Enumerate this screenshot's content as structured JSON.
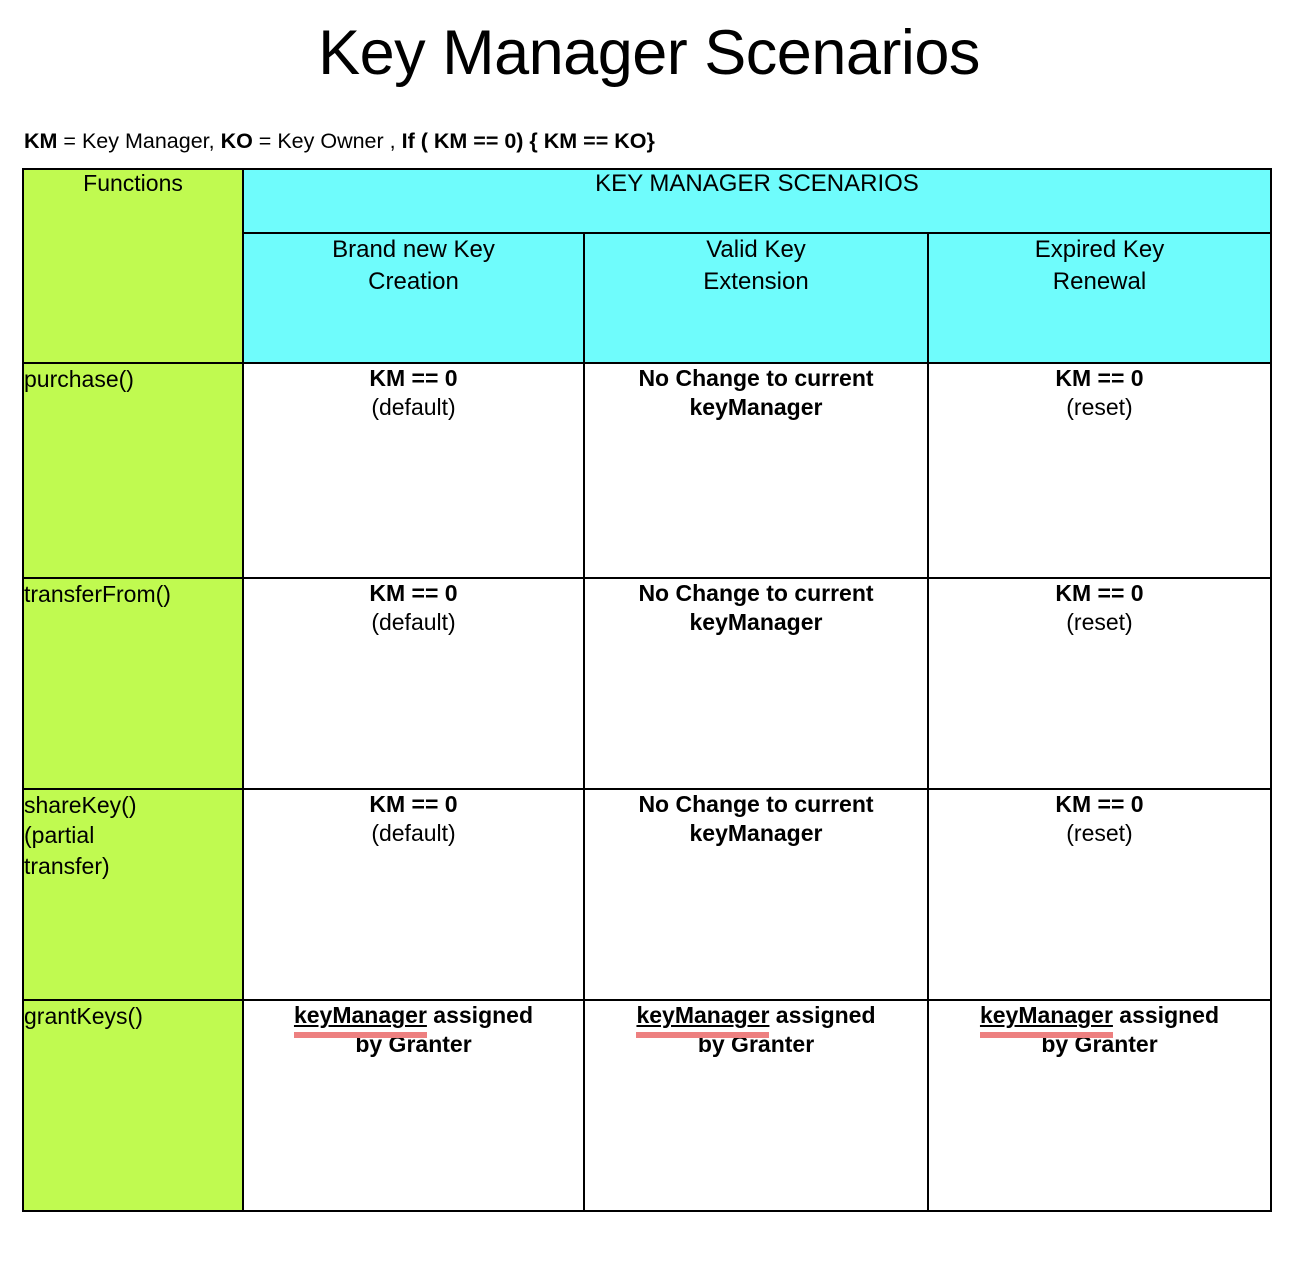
{
  "title": "Key Manager Scenarios",
  "legend": {
    "km_abbr": "KM",
    "km_text": " = Key Manager,  ",
    "ko_abbr": "KO",
    "ko_text": " = Key Owner , ",
    "condition": " If ( KM == 0) { KM == KO}"
  },
  "colors": {
    "function_column": "#c0fa50",
    "header_band": "#6ffcfc",
    "highlight_underline": "#ed8080",
    "border": "#000000",
    "cell_background": "#ffffff"
  },
  "table": {
    "function_header": "Functions",
    "group_header": "KEY MANAGER SCENARIOS",
    "columns": [
      {
        "line1": "Brand new Key",
        "line2": "Creation"
      },
      {
        "line1": "Valid Key",
        "line2": "Extension"
      },
      {
        "line1": "Expired Key",
        "line2": "Renewal"
      }
    ],
    "rows": [
      {
        "function": "purchase()",
        "function_lines": [
          "purchase()"
        ],
        "cells": [
          {
            "bold": "KM == 0",
            "plain": "(default)"
          },
          {
            "bold": "No Change to current",
            "bold2": "keyManager",
            "plain": ""
          },
          {
            "bold": "KM == 0",
            "plain": "(reset)"
          }
        ]
      },
      {
        "function": "transferFrom()",
        "function_lines": [
          "transferFrom()"
        ],
        "cells": [
          {
            "bold": "KM == 0",
            "plain": "(default)"
          },
          {
            "bold": "No Change to current",
            "bold2": "keyManager",
            "plain": ""
          },
          {
            "bold": "KM == 0",
            "plain": "(reset)"
          }
        ]
      },
      {
        "function": "shareKey() (partial transfer)",
        "function_lines": [
          "shareKey()",
          "(partial",
          "transfer)"
        ],
        "cells": [
          {
            "bold": "KM == 0",
            "plain": "(default)"
          },
          {
            "bold": "No Change to current",
            "bold2": "keyManager",
            "plain": ""
          },
          {
            "bold": "KM == 0",
            "plain": "(reset)"
          }
        ]
      },
      {
        "function": "grantKeys()",
        "function_lines": [
          "grantKeys()"
        ],
        "cells": [
          {
            "underlined": "keyManager",
            "bold": " assigned",
            "bold2": "by Granter"
          },
          {
            "underlined": "keyManager",
            "bold": " assigned",
            "bold2": "by Granter"
          },
          {
            "underlined": "keyManager",
            "bold": " assigned",
            "bold2": "by Granter"
          }
        ]
      }
    ]
  }
}
